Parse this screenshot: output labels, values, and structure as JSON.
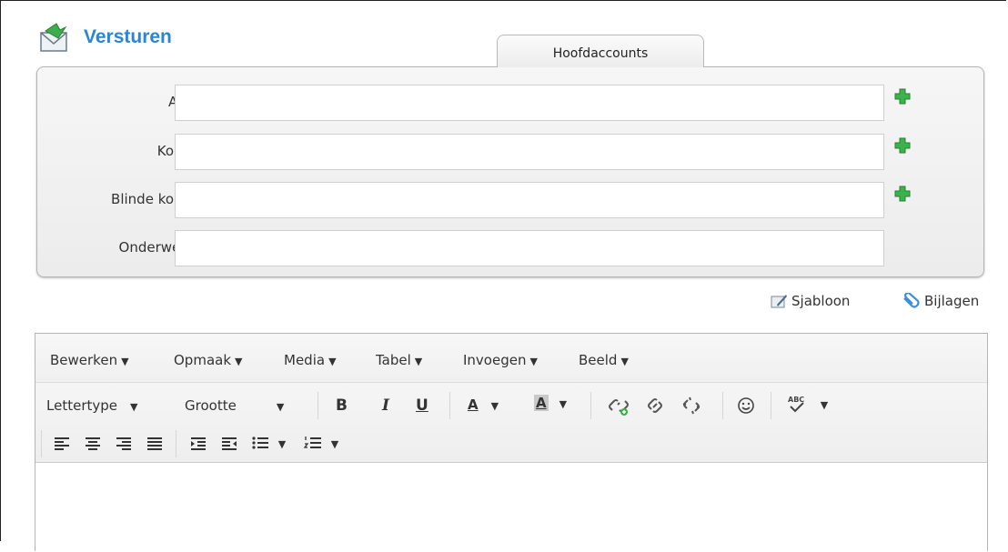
{
  "header": {
    "title": "Versturen",
    "icon": "envelope-send-icon"
  },
  "tab": {
    "label": "Hoofdaccounts"
  },
  "fields": {
    "to_label": "Aan:",
    "to_value": "",
    "cc_label": "Kopie:",
    "cc_value": "",
    "bcc_label": "Blinde kopie:",
    "bcc_value": "",
    "subject_label": "Onderwerp:",
    "subject_value": ""
  },
  "actions": {
    "template_label": "Sjabloon",
    "attachments_label": "Bijlagen"
  },
  "editor": {
    "menus": [
      "Bewerken",
      "Opmaak",
      "Media",
      "Tabel",
      "Invoegen",
      "Beeld"
    ],
    "font_label": "Lettertype",
    "size_label": "Grootte",
    "bold": "B",
    "italic": "I",
    "underline": "U",
    "text_color": "A",
    "bg_color": "A",
    "spellcheck": "ABC"
  },
  "colors": {
    "accent": "#2a86d4",
    "plus": "#39b54a"
  }
}
